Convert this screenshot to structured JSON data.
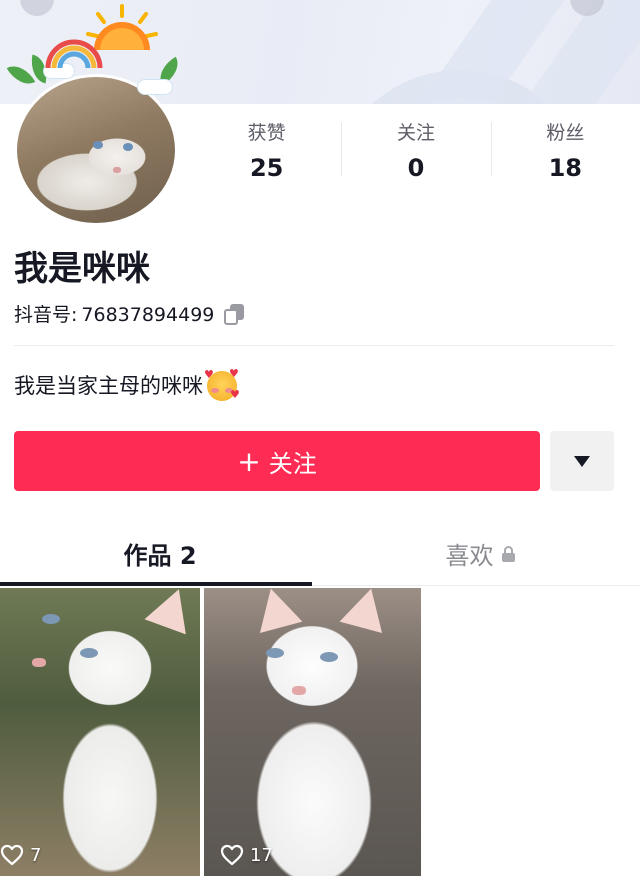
{
  "profile": {
    "nickname": "我是咪咪",
    "douyin_id_label": "抖音号:",
    "douyin_id": "76837894499",
    "bio": "我是当家主母的咪咪",
    "bio_emoji": "smiling-face-with-hearts-icon"
  },
  "stats": [
    {
      "label": "获赞",
      "value": "25"
    },
    {
      "label": "关注",
      "value": "0"
    },
    {
      "label": "粉丝",
      "value": "18"
    }
  ],
  "actions": {
    "follow_label": "关注",
    "follow_icon": "plus-icon",
    "more_icon": "caret-down-icon",
    "follow_color": "#fe2c55"
  },
  "tabs": [
    {
      "label": "作品 2",
      "active": true
    },
    {
      "label": "喜欢",
      "active": false,
      "icon": "lock-icon"
    }
  ],
  "videos": [
    {
      "likes": "7",
      "icon": "heart-outline-icon"
    },
    {
      "likes": "17",
      "icon": "heart-outline-icon"
    }
  ]
}
